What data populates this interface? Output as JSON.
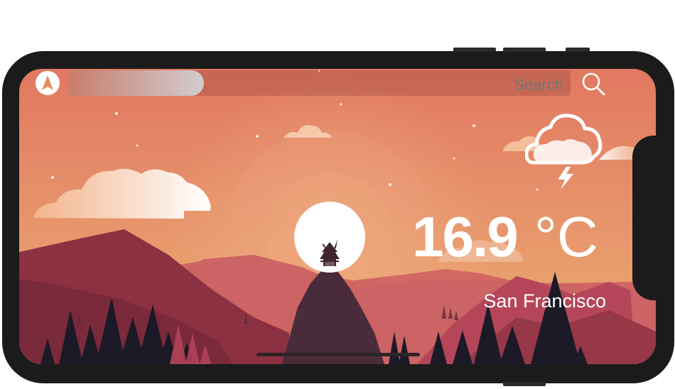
{
  "search": {
    "placeholder": "Search"
  },
  "weather": {
    "temperature": "16.9",
    "unit": "°C",
    "city": "San Francisco",
    "condition_icon": "cloud-lightning-icon"
  },
  "icons": {
    "app": "navigation-arrow-icon",
    "search": "magnifier-icon"
  },
  "colors": {
    "sky_top": "#e17860",
    "sky_bottom": "#ecae72",
    "mountain_dark": "#8a3041",
    "tree": "#1c1a26",
    "sun": "#ffffff"
  }
}
